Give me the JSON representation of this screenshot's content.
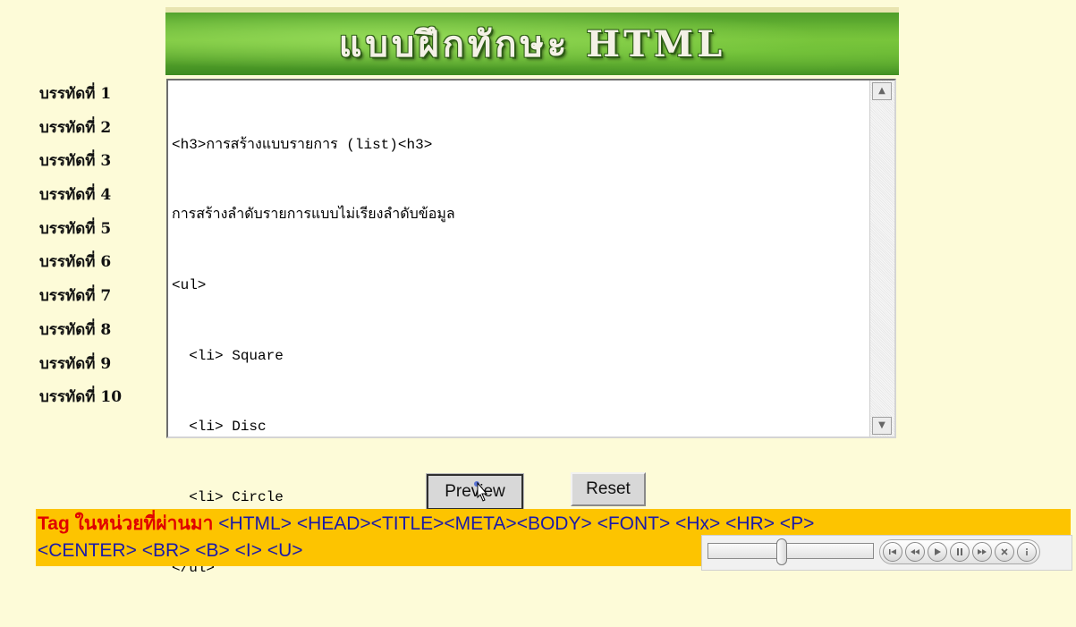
{
  "banner": {
    "title": "แบบฝึกทักษะ HTML"
  },
  "line_labels": [
    "บรรทัดที่ 1",
    "บรรทัดที่ 2",
    "บรรทัดที่ 3",
    "บรรทัดที่ 4",
    "บรรทัดที่ 5",
    "บรรทัดที่ 6",
    "บรรทัดที่ 7",
    "บรรทัดที่ 8",
    "บรรทัดที่ 9",
    "บรรทัดที่ 10"
  ],
  "editor": {
    "lines": [
      "<h3>การสร้างแบบรายการ (list)<h3>",
      "การสร้างลำดับรายการแบบไม่เรียงลำดับข้อมูล",
      "<ul>",
      "  <li> Square",
      "  <li> Disc",
      "  <li> Circle",
      "</ul>"
    ]
  },
  "buttons": {
    "preview": "Preview",
    "reset": "Reset"
  },
  "tags_bar": {
    "heading": "Tag ในหน่วยที่ผ่านมา",
    "line1": " <HTML> <HEAD><TITLE><META><BODY> <FONT> <Hx> <HR> <P>",
    "line2": "<CENTER> <BR> <B> <I> <U>"
  },
  "player": {
    "seek_position": 0.44,
    "controls": [
      "previous-icon",
      "rewind-icon",
      "play-icon",
      "pause-icon",
      "fast-forward-icon",
      "stop-icon",
      "info-icon"
    ]
  },
  "colors": {
    "tags_bar_bg": "#fdc400",
    "tags_heading": "#e00000",
    "tags_text": "#1a1aa8"
  }
}
